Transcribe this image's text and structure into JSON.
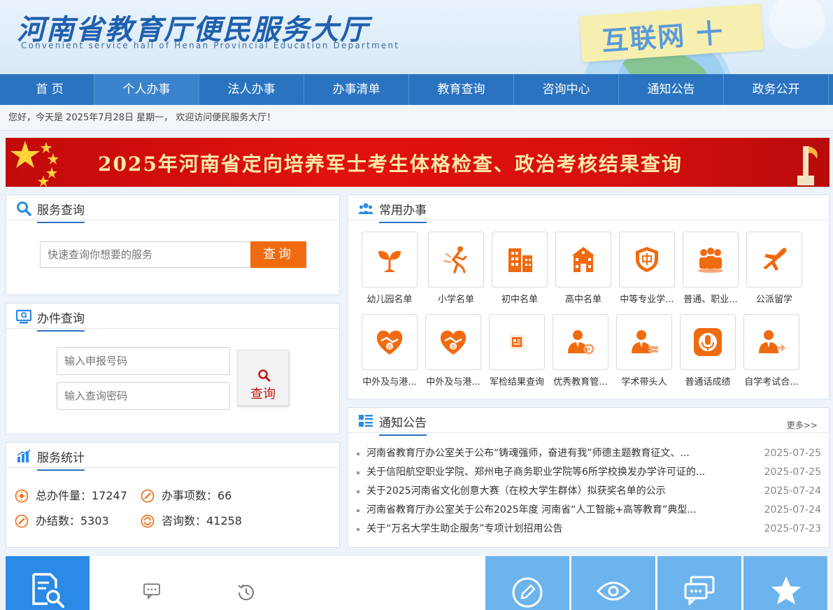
{
  "header": {
    "title": "河南省教育厅便民服务大厅",
    "subtitle": "Convenient service hall of Henan Provincial Education Department",
    "slogan": "互联网 十"
  },
  "nav": {
    "items": [
      {
        "label": "首 页"
      },
      {
        "label": "个人办事"
      },
      {
        "label": "法人办事"
      },
      {
        "label": "办事清单"
      },
      {
        "label": "教育查询"
      },
      {
        "label": "咨询中心"
      },
      {
        "label": "通知公告"
      },
      {
        "label": "政务公开"
      }
    ],
    "active_index": 1
  },
  "welcome": "您好，今天是 2025年7月28日 星期一， 欢迎访问便民服务大厅！",
  "banner": {
    "text": "2025年河南省定向培养军士考生体格检查、政治考核结果查询"
  },
  "service_query": {
    "title": "服务查询",
    "placeholder": "快速查询你想要的服务",
    "button": "查询"
  },
  "case_query": {
    "title": "办件查询",
    "code_placeholder": "输入申报号码",
    "password_placeholder": "输入查询密码",
    "button": "查询"
  },
  "stats": {
    "title": "服务统计",
    "total": "总办件量：17247",
    "items": "办事项数：66",
    "done": "办结数：5303",
    "consult": "咨询数：41258"
  },
  "common": {
    "title": "常用办事",
    "row1": [
      {
        "label": "幼儿园名单",
        "icon": "sprout-icon"
      },
      {
        "label": "小学名单",
        "icon": "running-child-icon"
      },
      {
        "label": "初中名单",
        "icon": "buildings-icon"
      },
      {
        "label": "高中名单",
        "icon": "school-icon"
      },
      {
        "label": "中等专业学...",
        "icon": "shield-icon"
      },
      {
        "label": "普通、职业...",
        "icon": "group-icon"
      },
      {
        "label": "公派留学",
        "icon": "airplane-icon"
      }
    ],
    "row2": [
      {
        "label": "中外及与港...",
        "icon": "handshake-heart-icon"
      },
      {
        "label": "中外及与港...",
        "icon": "handshake-heart-icon"
      },
      {
        "label": "军检结果查询",
        "icon": "document-icon"
      },
      {
        "label": "优秀教育管...",
        "icon": "manager-gear-icon"
      },
      {
        "label": "学术带头人",
        "icon": "person-money-icon"
      },
      {
        "label": "普通话成绩",
        "icon": "microphone-icon"
      },
      {
        "label": "自学考试合...",
        "icon": "person-arrow-icon"
      }
    ]
  },
  "notice": {
    "title": "通知公告",
    "more": "更多>>",
    "rows": [
      {
        "title": "河南省教育厅办公室关于公布“铸魂强师，奋进有我”师德主题教育征文、...",
        "date": "2025-07-25"
      },
      {
        "title": "关于信阳航空职业学院、郑州电子商务职业学院等6所学校换发办学许可证的...",
        "date": "2025-07-25"
      },
      {
        "title": "关于2025河南省文化创意大赛（在校大学生群体）拟获奖名单的公示",
        "date": "2025-07-24"
      },
      {
        "title": "河南省教育厅办公室关于公布2025年度 河南省“人工智能+高等教育”典型...",
        "date": "2025-07-24"
      },
      {
        "title": "关于“万名大学生助企服务”专项计划招用公告",
        "date": "2025-07-23"
      }
    ]
  },
  "colors": {
    "nav_blue": "#2a73c0",
    "orange": "#f06a10",
    "banner_red": "#d6100e",
    "tile_blue": "#6cb4ee"
  }
}
